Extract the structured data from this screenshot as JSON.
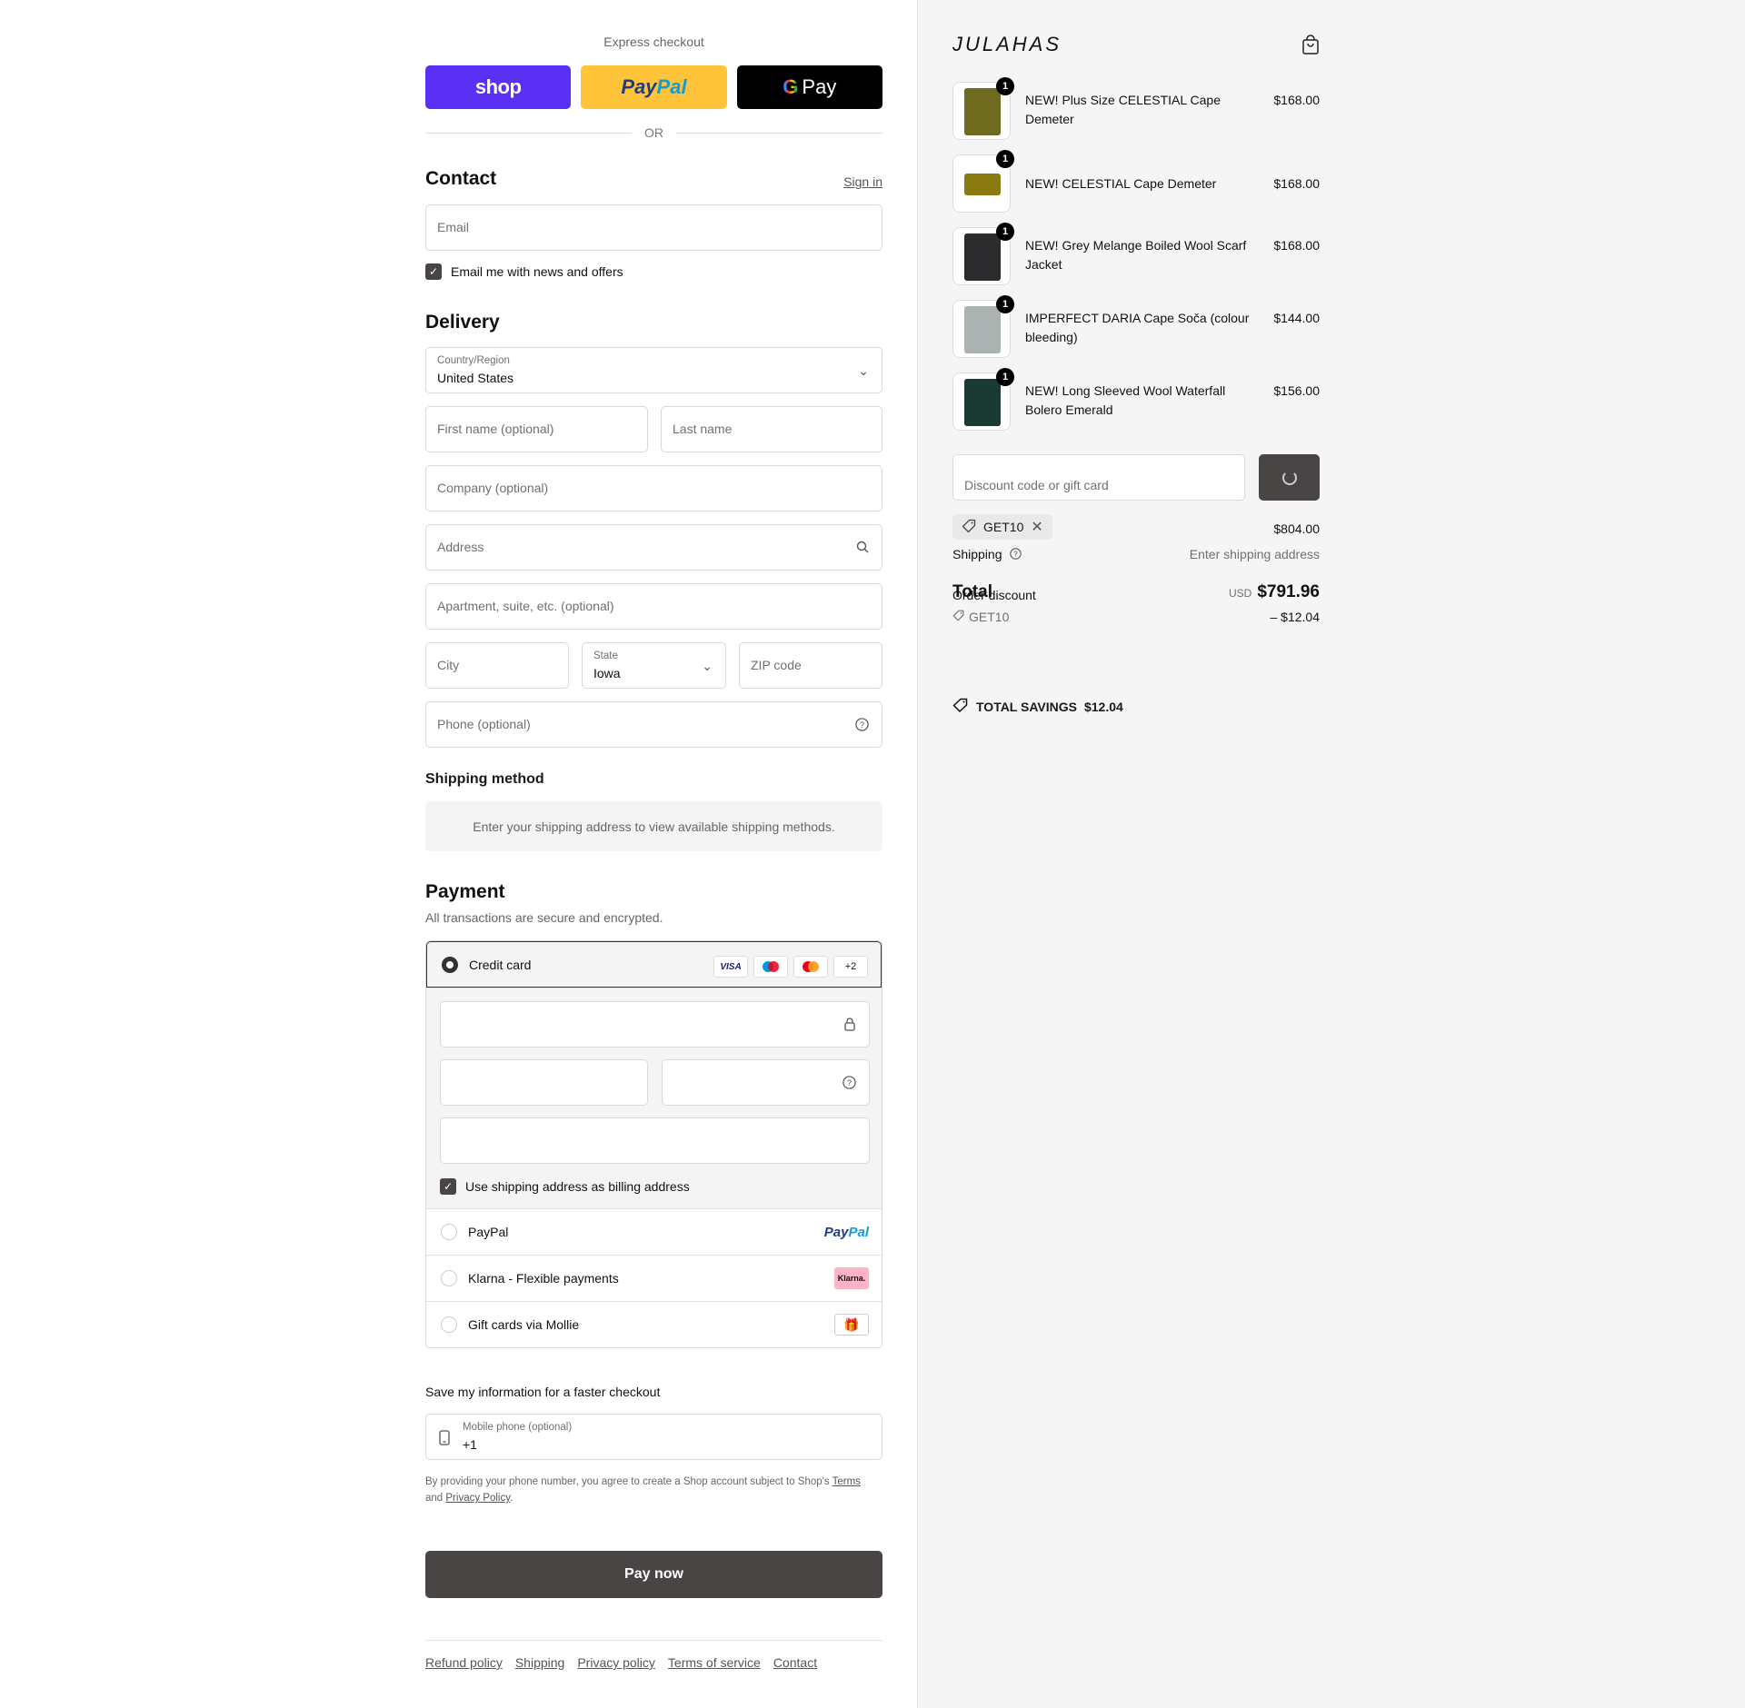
{
  "express": {
    "label": "Express checkout",
    "shop_label": "shop",
    "paypal_a": "Pay",
    "paypal_b": "Pal",
    "gpay_g": "G",
    "gpay_label": "Pay",
    "or_label": "OR"
  },
  "contact": {
    "title": "Contact",
    "sign_in": "Sign in",
    "email_placeholder": "Email",
    "news_label": "Email me with news and offers",
    "news_checked": true
  },
  "delivery": {
    "title": "Delivery",
    "country_label": "Country/Region",
    "country_value": "United States",
    "first_name_placeholder": "First name (optional)",
    "last_name_placeholder": "Last name",
    "company_placeholder": "Company (optional)",
    "address_placeholder": "Address",
    "apartment_placeholder": "Apartment, suite, etc. (optional)",
    "city_placeholder": "City",
    "state_label": "State",
    "state_value": "Iowa",
    "zip_placeholder": "ZIP code",
    "phone_placeholder": "Phone (optional)"
  },
  "shipping_method": {
    "title": "Shipping method",
    "message": "Enter your shipping address to view available shipping methods."
  },
  "payment": {
    "title": "Payment",
    "subtitle": "All transactions are secure and encrypted.",
    "credit_card_label": "Credit card",
    "card_logos": [
      "VISA",
      "Maestro",
      "Mastercard",
      "+2"
    ],
    "more_label": "+2",
    "visa_label": "VISA",
    "billing_label": "Use shipping address as billing address",
    "billing_checked": true,
    "paypal_label": "PayPal",
    "paypal_logo_a": "Pay",
    "paypal_logo_b": "Pal",
    "klarna_label": "Klarna - Flexible payments",
    "klarna_logo": "Klarna.",
    "mollie_label": "Gift cards via Mollie"
  },
  "save_info": {
    "title": "Save my information for a faster checkout",
    "mobile_label": "Mobile phone (optional)",
    "mobile_value": "+1",
    "legal_a": "By providing your phone number, you agree to create a Shop account subject to Shop's ",
    "legal_terms": "Terms",
    "legal_b": "and ",
    "legal_privacy": "Privacy Policy",
    "legal_c": "."
  },
  "pay_now": "Pay now",
  "footer_links": [
    "Refund policy",
    "Shipping",
    "Privacy policy",
    "Terms of service",
    "Contact"
  ],
  "summary": {
    "brand": "JULAHAS",
    "items": [
      {
        "name": "NEW! Plus Size CELESTIAL Cape Demeter",
        "price": "$168.00",
        "qty": "1",
        "color": "#6e6a1e"
      },
      {
        "name": "NEW! CELESTIAL Cape Demeter",
        "price": "$168.00",
        "qty": "1",
        "color": "#8a7a10"
      },
      {
        "name": "NEW! Grey Melange Boiled Wool Scarf Jacket",
        "price": "$168.00",
        "qty": "1",
        "color": "#2b2b2e"
      },
      {
        "name": "IMPERFECT DARIA Cape Soča (colour bleeding)",
        "price": "$144.00",
        "qty": "1",
        "color": "#aab3b2"
      },
      {
        "name": "NEW! Long Sleeved Wool Waterfall Bolero Emerald",
        "price": "$156.00",
        "qty": "1",
        "color": "#1c3a34"
      }
    ],
    "discount_placeholder": "Discount code or gift card",
    "applied_code": "GET10",
    "subtotal_value": "$804.00",
    "shipping_label": "Shipping",
    "shipping_value": "Enter shipping address",
    "total_label": "Total",
    "total_currency": "USD",
    "total_value": "$791.96",
    "order_discount_label": "Order discount",
    "order_discount_code": "GET10",
    "order_discount_value": "– $12.04",
    "savings_label": "TOTAL SAVINGS",
    "savings_value": "$12.04"
  }
}
